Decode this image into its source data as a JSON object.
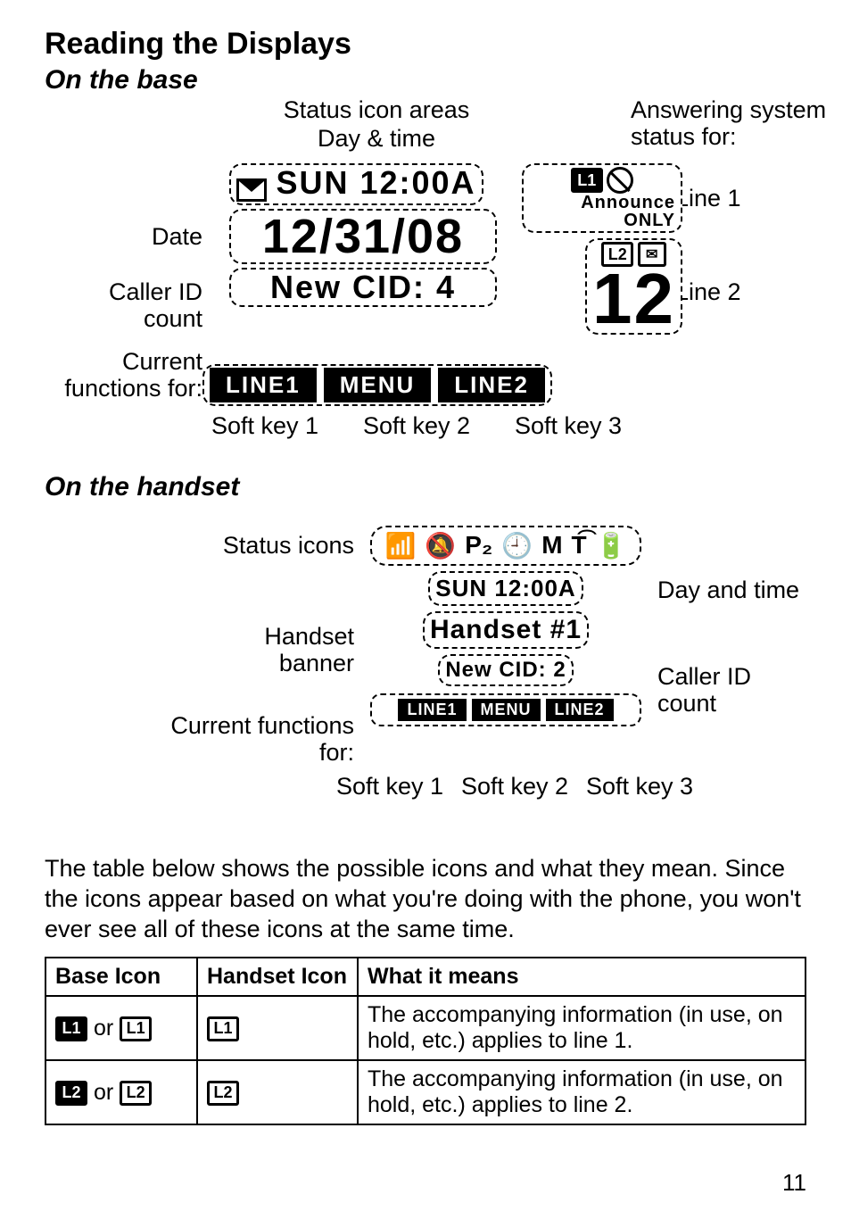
{
  "title": "Reading the Displays",
  "sections": {
    "base": {
      "heading": "On the base",
      "callouts": {
        "status_icon_areas": "Status icon areas",
        "day_time": "Day & time",
        "date": "Date",
        "caller_id_count": "Caller ID count",
        "current_functions_for": "Current functions for:",
        "soft_key_1": "Soft key 1",
        "soft_key_2": "Soft key 2",
        "soft_key_3": "Soft key 3",
        "answering_system_status_for": "Answering system status for:",
        "line_1": "Line 1",
        "line_2": "Line 2"
      },
      "lcd": {
        "day_time": "SUN  12:00A",
        "date": "12/31/08",
        "cid": "New CID: 4",
        "softkeys": [
          "LINE1",
          "MENU",
          "LINE2"
        ],
        "right": {
          "l1_badge": "L1",
          "announce_only": "Announce ONLY",
          "l2_badge": "L2",
          "msg_count": "12"
        }
      }
    },
    "handset": {
      "heading": "On the handset",
      "callouts": {
        "status_icons": "Status icons",
        "day_and_time": "Day and time",
        "handset_banner": "Handset banner",
        "caller_id_count": "Caller ID count",
        "current_functions_for": "Current functions for:",
        "soft_key_1": "Soft key 1",
        "soft_key_2": "Soft key 2",
        "soft_key_3": "Soft key 3"
      },
      "lcd": {
        "icons": [
          "📶",
          "🔕",
          "P₂",
          "🕘",
          "M",
          "T͡",
          "🔋"
        ],
        "day_time": "SUN 12:00A",
        "banner": "Handset #1",
        "cid": "New CID: 2",
        "softkeys": [
          "LINE1",
          "MENU",
          "LINE2"
        ]
      }
    }
  },
  "body_text": "The table below shows the possible icons and what they mean. Since the icons appear based on what you're doing with the phone, you won't ever see all of these icons at the same time.",
  "table": {
    "headers": [
      "Base Icon",
      "Handset Icon",
      "What it means"
    ],
    "rows": [
      {
        "base_icon_a": "L1",
        "base_icon_b": "L1",
        "sep": " or ",
        "handset_icon": "L1",
        "meaning": "The accompanying information (in use, on hold, etc.) applies to line 1."
      },
      {
        "base_icon_a": "L2",
        "base_icon_b": "L2",
        "sep": " or ",
        "handset_icon": "L2",
        "meaning": "The accompanying information (in use, on hold, etc.) applies to line 2."
      }
    ]
  },
  "page_number": "11"
}
